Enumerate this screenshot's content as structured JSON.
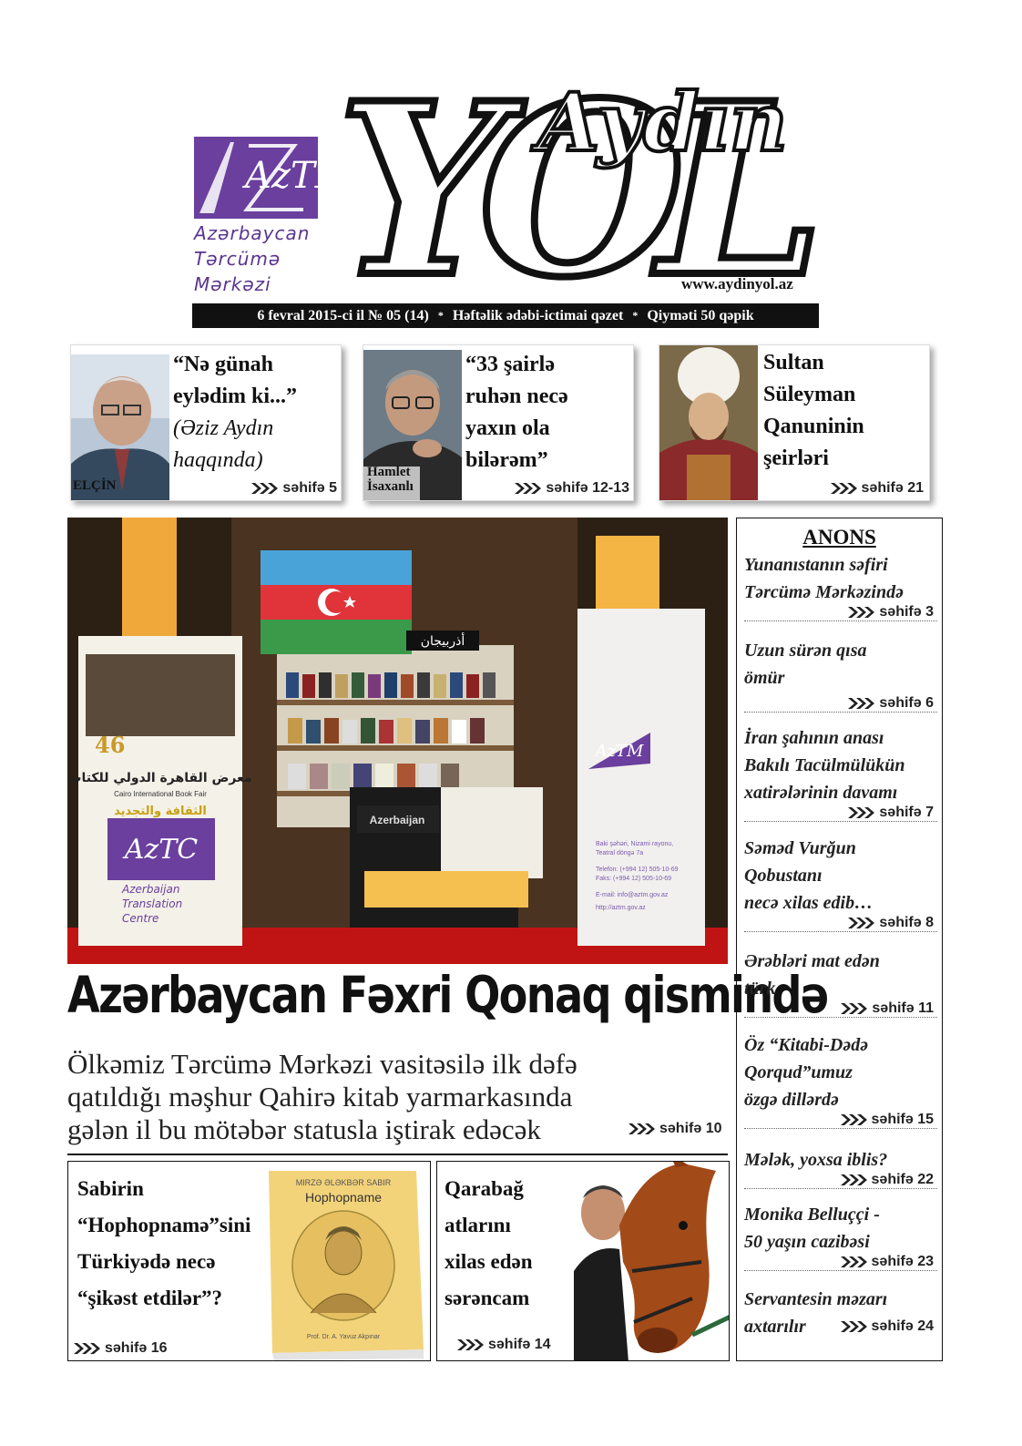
{
  "masthead": {
    "logo_text": "AzTM",
    "logo_lines": [
      "Azərbaycan",
      "Tərcümə",
      "Mərkəzi"
    ],
    "title_word1": "Aydın",
    "title_word2": "YOL",
    "url": "www.aydinyol.az",
    "info": [
      "6 fevral 2015-ci il № 05 (14)",
      "Həftəlik ədəbi-ictimai qəzet",
      "Qiymәti 50 qəpik"
    ],
    "separator": "*"
  },
  "teasers": [
    {
      "headline_lines": [
        "“Nə günah",
        "eylədim ki...”"
      ],
      "sub_lines": [
        "(Əziz Aydın",
        "haqqında)"
      ],
      "caption": "ELÇİN",
      "page": "səhifə 5"
    },
    {
      "headline_lines": [
        "“33 şairlə",
        "ruhən necə",
        "yaxın ola",
        "bilərəm”"
      ],
      "caption_lines": [
        "Hamlet",
        "İsaxanlı"
      ],
      "page": "səhifə 12-13"
    },
    {
      "headline_lines": [
        "Sultan",
        "Süleyman",
        "Qanuninin",
        "şeirləri"
      ],
      "page": "səhifə 21"
    }
  ],
  "hero": {
    "banner_number": "46",
    "banner_en": "Cairo International Book Fair",
    "banner_ar_1": "معرض القاهرة الدولي للكتاب",
    "banner_ar_2": "الثقافة والتجديد",
    "banner_logo": "AzTC",
    "banner_lines": [
      "Azerbaijan",
      "Translation",
      "Centre"
    ],
    "booth_sign_ar": "أذربيجان",
    "booth_label": "Azerbaijan",
    "side_logo": "AzTM",
    "side_text": [
      "Baki şəhəri, Nizami rayonu,",
      "Teatral döngə 7a",
      "Telefon: (+994 12) 505-10-69",
      "Faks: (+994 12) 505-10-69",
      "E-mail: info@aztm.gov.az",
      "http://aztm.gov.az"
    ]
  },
  "main_story": {
    "headline": "Azərbaycan Fəxri Qonaq qismində",
    "lead_lines": [
      "Ölkəmiz Tərcümə Mərkəzi vasitəsilə ilk dəfə",
      "qatıldığı məşhur Qahirə kitab yarmarkasında",
      "gələn il bu mötəbər statusla iştirak edəcək"
    ],
    "page": "səhifə 10"
  },
  "bottom": [
    {
      "headline_lines": [
        "Sabirin",
        "“Hophopnamə”sini",
        "Türkiyədə necə",
        "“şikəst etdilər”?"
      ],
      "book_top": "MIRZƏ ƏLƏKBƏR SABIR",
      "book_title": "Hophopname",
      "book_bottom": "Prof. Dr. A. Yavuz Akpınar",
      "page": "səhifə 16"
    },
    {
      "headline_lines": [
        "Qarabağ",
        "atlarını",
        "xilas edən",
        "sərəncam"
      ],
      "page": "səhifə 14"
    }
  ],
  "anons": {
    "title": "ANONS",
    "items": [
      {
        "lines": [
          "Yunanıstanın səfiri",
          "Tərcümə Mərkəzində"
        ],
        "page": "səhifə 3"
      },
      {
        "lines": [
          "Uzun sürən qısa",
          "ömür"
        ],
        "page": "səhifə 6"
      },
      {
        "lines": [
          "İran şahının anası",
          "Bakılı Tacülmülükün",
          "xatirələrinin davamı"
        ],
        "page": "səhifə 7"
      },
      {
        "lines": [
          "Səməd Vurğun",
          "Qobustanı",
          "necə xilas edib…"
        ],
        "page": "səhifə 8"
      },
      {
        "lines": [
          "Ərəbləri mat edən",
          "türk"
        ],
        "page": "səhifə 11"
      },
      {
        "lines": [
          "Öz “Kitabi-Dədə",
          "Qorqud”umuz",
          "özgə dillərdə"
        ],
        "page": "səhifə 15"
      },
      {
        "lines": [
          "Mələk, yoxsa iblis?"
        ],
        "page": "səhifə 22"
      },
      {
        "lines": [
          "Monika Belluççi -",
          "50 yaşın cazibəsi"
        ],
        "page": "səhifə 23"
      },
      {
        "lines": [
          "Servantesin məzarı",
          "axtarılır"
        ],
        "page": "səhifə 24"
      }
    ]
  },
  "colors": {
    "brand_purple": "#6a3f9e",
    "ink": "#111111"
  },
  "icons": [
    "triple-chevron-icon",
    "azerbaijan-flag-icon",
    "crescent-star-icon"
  ]
}
